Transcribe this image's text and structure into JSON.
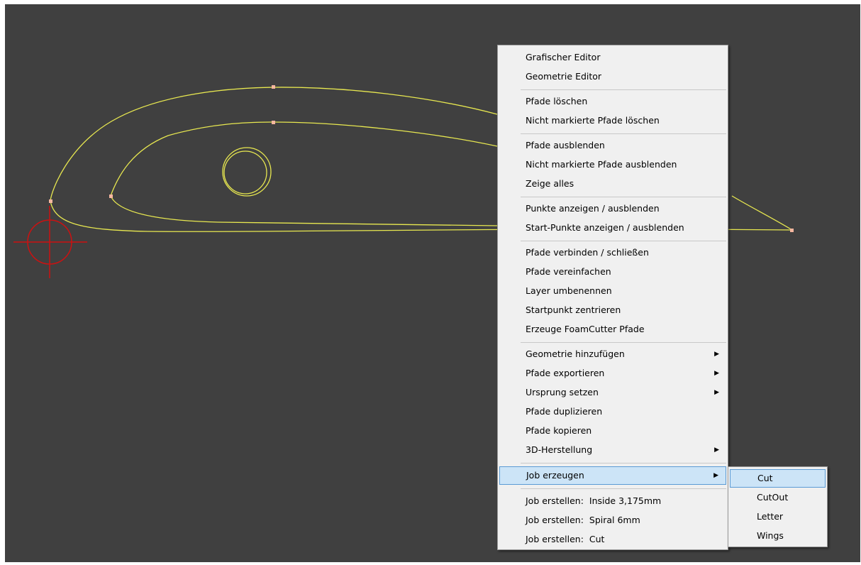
{
  "context_menu": {
    "items": [
      {
        "label": "Grafischer Editor"
      },
      {
        "label": "Geometrie Editor"
      },
      {
        "label": "Pfade löschen"
      },
      {
        "label": "Nicht markierte Pfade löschen"
      },
      {
        "label": "Pfade ausblenden"
      },
      {
        "label": "Nicht markierte Pfade ausblenden"
      },
      {
        "label": "Zeige alles"
      },
      {
        "label": "Punkte anzeigen / ausblenden"
      },
      {
        "label": "Start-Punkte anzeigen / ausblenden"
      },
      {
        "label": "Pfade verbinden / schließen"
      },
      {
        "label": "Pfade vereinfachen"
      },
      {
        "label": "Layer umbenennen"
      },
      {
        "label": "Startpunkt zentrieren"
      },
      {
        "label": "Erzeuge FoamCutter Pfade"
      },
      {
        "label": "Geometrie hinzufügen",
        "arrow": "▶"
      },
      {
        "label": "Pfade exportieren",
        "arrow": "▶"
      },
      {
        "label": "Ursprung setzen",
        "arrow": "▶"
      },
      {
        "label": "Pfade duplizieren"
      },
      {
        "label": "Pfade kopieren"
      },
      {
        "label": "3D-Herstellung",
        "arrow": "▶"
      },
      {
        "label": "Job erzeugen",
        "arrow": "▶",
        "highlighted": true
      },
      {
        "label": "Job erstellen:  Inside 3,175mm"
      },
      {
        "label": "Job erstellen:  Spiral 6mm"
      },
      {
        "label": "Job erstellen:  Cut"
      }
    ]
  },
  "submenu": {
    "items": [
      {
        "label": "Cut",
        "highlighted": true
      },
      {
        "label": "CutOut"
      },
      {
        "label": "Letter"
      },
      {
        "label": "Wings"
      }
    ]
  },
  "colors": {
    "canvas_bg": "#404040",
    "path": "#e8e850",
    "point": "#f5b7a0",
    "origin_marker": "#cc1111",
    "highlight_bg": "#cce4f7",
    "highlight_border": "#5a9bd5"
  }
}
